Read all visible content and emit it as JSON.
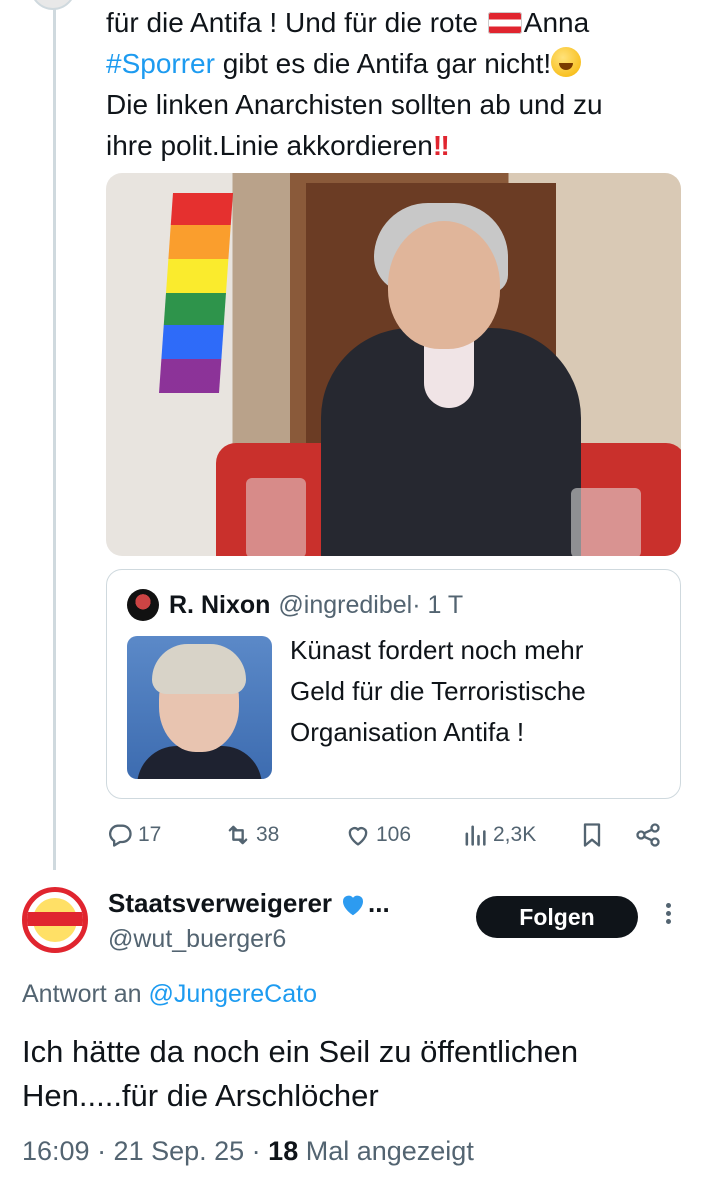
{
  "tweet": {
    "line1_a": "für die Antifa ! Und für die rote ",
    "line1_b": "Anna",
    "hashtag": "#Sporrer",
    "line2": " gibt es die Antifa gar nicht!",
    "line3": "Die linken Anarchisten sollten ab und zu",
    "line4": "ihre polit.Linie akkordieren",
    "bang": "‼"
  },
  "quote": {
    "name": "R. Nixon",
    "handle": "@ingredibel",
    "time": " · 1 T",
    "text_line1": "Künast fordert noch mehr",
    "text_line2": "Geld für die  Terroristische",
    "text_line3": "Organisation Antifa !"
  },
  "actions": {
    "replies": "17",
    "reposts": "38",
    "likes": "106",
    "views": "2,3K"
  },
  "reply": {
    "name": "Staatsverweigerer",
    "ellipsis": "...",
    "handle": "@wut_buerger6",
    "follow_label": "Folgen",
    "reply_to_label": "Antwort an ",
    "reply_to_mention": "@JungereCato",
    "text_line1": "Ich hätte da noch ein Seil zu öffentlichen",
    "text_line2": "Hen.....für die Arschlöcher",
    "time": "16:09 · 21 Sep. 25 · ",
    "views_count": "18",
    "views_label": " Mal angezeigt"
  },
  "colors": {
    "accent": "#1d9bf0",
    "text": "#0f1419",
    "muted": "#536471",
    "border": "#cfd9de"
  },
  "icons": [
    "reply-icon",
    "repost-icon",
    "like-icon",
    "views-icon",
    "bookmark-icon",
    "share-icon",
    "blue-heart-icon",
    "more-icon"
  ]
}
